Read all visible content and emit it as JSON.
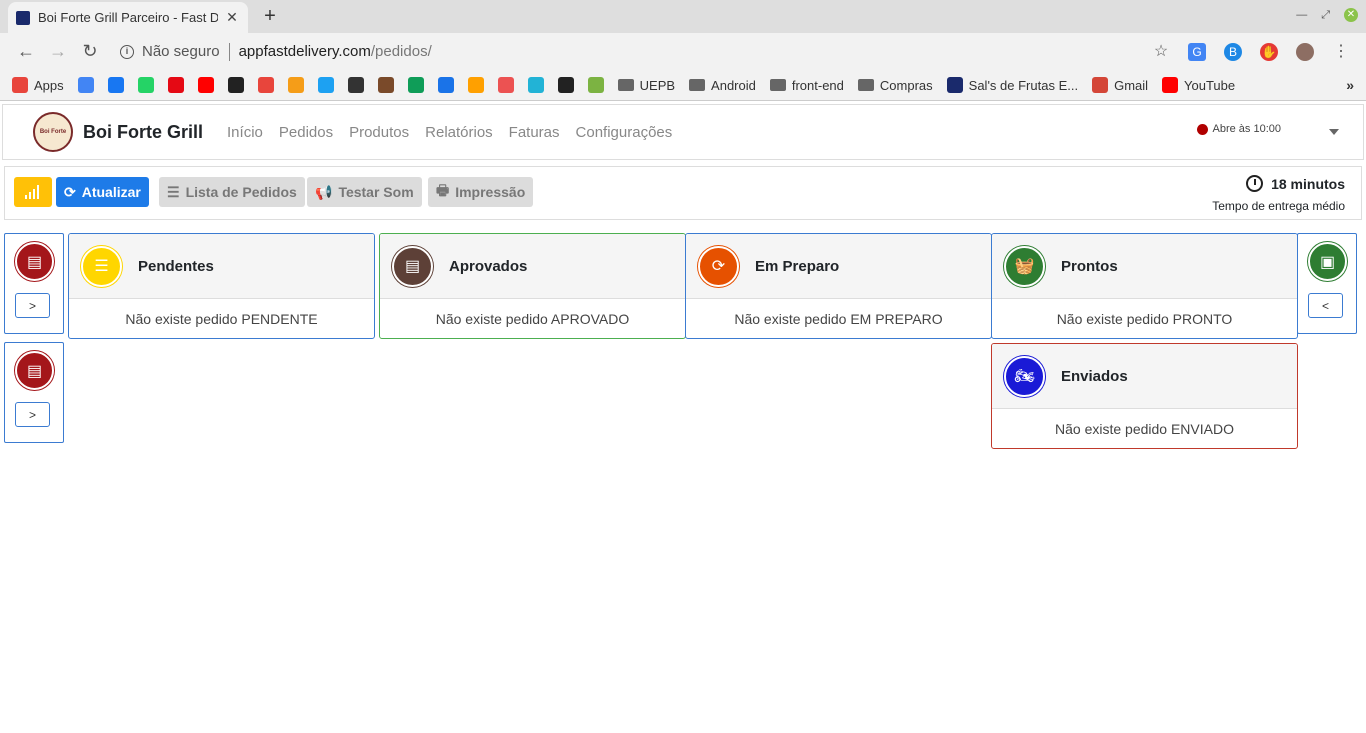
{
  "browser": {
    "tab_title": "Boi Forte Grill Parceiro - Fast Delivery",
    "new_tab": "+",
    "url_not_secure": "Não seguro",
    "url_host": "appfastdelivery.com",
    "url_path": "/pedidos/"
  },
  "bookmarks": [
    {
      "label": "Apps",
      "icon": "apps-grid-icon",
      "color": "#e8453c"
    },
    {
      "label": "",
      "icon": "calendar-icon",
      "color": "#4285f4"
    },
    {
      "label": "",
      "icon": "facebook-icon",
      "color": "#1877f2"
    },
    {
      "label": "",
      "icon": "whatsapp-icon",
      "color": "#25d366"
    },
    {
      "label": "",
      "icon": "netflix-icon",
      "color": "#e50914"
    },
    {
      "label": "",
      "icon": "youtube-icon",
      "color": "#ff0000"
    },
    {
      "label": "",
      "icon": "github-icon",
      "color": "#222222"
    },
    {
      "label": "",
      "icon": "figma-icon",
      "color": "#e8453c"
    },
    {
      "label": "",
      "icon": "lion-icon",
      "color": "#f59d18"
    },
    {
      "label": "",
      "icon": "twitter-icon",
      "color": "#1da1f2"
    },
    {
      "label": "",
      "icon": "trello-icon",
      "color": "#333333"
    },
    {
      "label": "",
      "icon": "book-icon",
      "color": "#7a4a2a"
    },
    {
      "label": "",
      "icon": "drive-icon",
      "color": "#0f9d58"
    },
    {
      "label": "",
      "icon": "ap-icon",
      "color": "#1a73e8"
    },
    {
      "label": "",
      "icon": "firebase-icon",
      "color": "#ffa000"
    },
    {
      "label": "",
      "icon": "udemy-icon",
      "color": "#ec5252"
    },
    {
      "label": "",
      "icon": "webflow-icon",
      "color": "#22b3d6"
    },
    {
      "label": "",
      "icon": "k-icon",
      "color": "#222222"
    },
    {
      "label": "",
      "icon": "kiwi-icon",
      "color": "#7cb342"
    },
    {
      "label": "UEPB",
      "icon": "folder-icon",
      "color": "#666666"
    },
    {
      "label": "Android",
      "icon": "folder-icon",
      "color": "#666666"
    },
    {
      "label": "front-end",
      "icon": "folder-icon",
      "color": "#666666"
    },
    {
      "label": "Compras",
      "icon": "folder-icon",
      "color": "#666666"
    },
    {
      "label": "Sal's de Frutas E...",
      "icon": "site-icon",
      "color": "#1a2a6c"
    },
    {
      "label": "Gmail",
      "icon": "gmail-icon",
      "color": "#d44638"
    },
    {
      "label": "YouTube",
      "icon": "youtube-icon",
      "color": "#ff0000"
    }
  ],
  "bookmarks_more": "»",
  "app": {
    "brand": "Boi Forte Grill",
    "logo_text": "Boi Forte",
    "menu": [
      "Início",
      "Pedidos",
      "Produtos",
      "Relatórios",
      "Faturas",
      "Configurações"
    ],
    "status": "Abre às 10:00"
  },
  "actions": {
    "update": "Atualizar",
    "orders_list": "Lista de Pedidos",
    "test_sound": "Testar Som",
    "print": "Impressão",
    "avg_time": "18 minutos",
    "avg_label": "Tempo de entrega médio"
  },
  "side": {
    "next": ">",
    "prev": "<"
  },
  "columns": [
    {
      "title": "Pendentes",
      "empty": "Não existe pedido PENDENTE",
      "color": "#ffd600",
      "border": "#3b7bd1"
    },
    {
      "title": "Aprovados",
      "empty": "Não existe pedido APROVADO",
      "color": "#5d4037",
      "border": "#4caf50"
    },
    {
      "title": "Em Preparo",
      "empty": "Não existe pedido EM PREPARO",
      "color": "#e65100",
      "border": "#3b7bd1"
    },
    {
      "title": "Prontos",
      "empty": "Não existe pedido PRONTO",
      "color": "#2e7d32",
      "border": "#3b7bd1"
    },
    {
      "title": "Enviados",
      "empty": "Não existe pedido ENVIADO",
      "color": "#1a1ad6",
      "border": "#c0392b"
    }
  ]
}
